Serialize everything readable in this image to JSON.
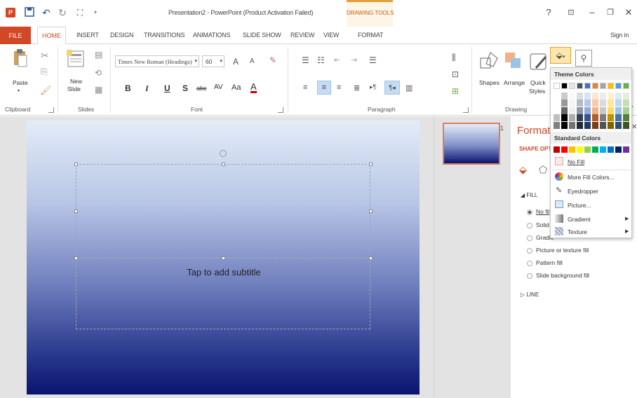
{
  "window": {
    "title": "Presentation2 - PowerPoint (Product Activation Failed)",
    "contextual_tab": "DRAWING TOOLS",
    "help": "?",
    "sign_in": "Sign in"
  },
  "tabs": [
    "FILE",
    "HOME",
    "INSERT",
    "DESIGN",
    "TRANSITIONS",
    "ANIMATIONS",
    "SLIDE SHOW",
    "REVIEW",
    "VIEW",
    "FORMAT"
  ],
  "ribbon": {
    "clipboard": {
      "label": "Clipboard",
      "paste": "Paste"
    },
    "slides": {
      "label": "Slides",
      "new_slide_1": "New",
      "new_slide_2": "Slide"
    },
    "font": {
      "label": "Font",
      "font_name": "Times New Roman (Headings)",
      "font_size": "60",
      "bold": "B",
      "italic": "I",
      "underline": "U",
      "shadow": "S",
      "strike": "abc",
      "spacing": "AV",
      "case": "Aa",
      "color": "A",
      "grow": "A",
      "shrink": "A"
    },
    "paragraph": {
      "label": "Paragraph"
    },
    "drawing": {
      "label": "Drawing",
      "shapes": "Shapes",
      "arrange": "Arrange",
      "quick_1": "Quick",
      "quick_2": "Styles"
    }
  },
  "slide": {
    "number": "1",
    "subtitle_placeholder": "Tap to add subtitle"
  },
  "format_pane": {
    "title": "Format",
    "tab": "SHAPE OPT",
    "fill_header": "FILL",
    "line_header": "LINE",
    "fill_options": [
      "No fil",
      "Solid",
      "Gradie",
      "Picture or texture fill",
      "Pattern fill",
      "Slide background fill"
    ]
  },
  "color_menu": {
    "theme_header": "Theme Colors",
    "standard_header": "Standard Colors",
    "items": [
      "No Fill",
      "More Fill Colors...",
      "Eyedropper",
      "Picture...",
      "Gradient",
      "Texture"
    ],
    "theme_top": [
      "#ffffff",
      "#000000",
      "#e7e6e6",
      "#44546a",
      "#4472c4",
      "#ed7d31",
      "#a5a5a5",
      "#ffc000",
      "#5b9bd5",
      "#70ad47"
    ],
    "standard": [
      "#c00000",
      "#ff0000",
      "#ffc000",
      "#ffff00",
      "#92d050",
      "#00b050",
      "#00b0f0",
      "#0070c0",
      "#002060",
      "#7030a0"
    ]
  },
  "colors": {
    "accent": "#d24726",
    "contextual": "#e2a03a",
    "slide_top": "#e4ecf8",
    "slide_bottom": "#0a1470"
  }
}
